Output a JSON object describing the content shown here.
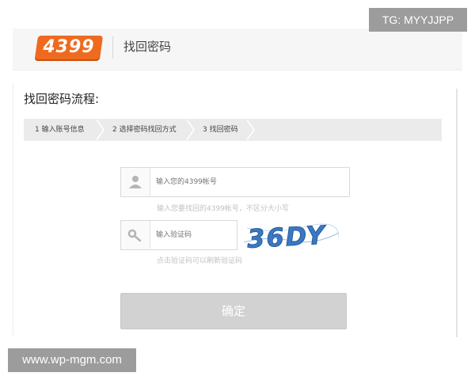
{
  "header": {
    "logo_text": "4399",
    "title": "找回密码"
  },
  "overlay": {
    "tg_badge": "TG: MYYJJPP",
    "watermark": "www.wp-mgm.com"
  },
  "flow": {
    "title": "找回密码流程:",
    "steps": [
      {
        "label": "1 输入账号信息"
      },
      {
        "label": "2 选择密码找回方式"
      },
      {
        "label": "3 找回密码"
      }
    ]
  },
  "form": {
    "account": {
      "icon": "user-icon",
      "placeholder": "输入您的4399帐号",
      "hint": "输入您要找回的4399帐号，不区分大小写"
    },
    "captcha": {
      "icon": "key-icon",
      "placeholder": "输入验证码",
      "image_text": "36DY",
      "hint": "点击验证码可以刷新验证码"
    },
    "submit_label": "确定"
  },
  "colors": {
    "logo": "#ef6a1f",
    "captcha_text": "#3a78c4",
    "button_disabled": "#d2d2d2"
  }
}
